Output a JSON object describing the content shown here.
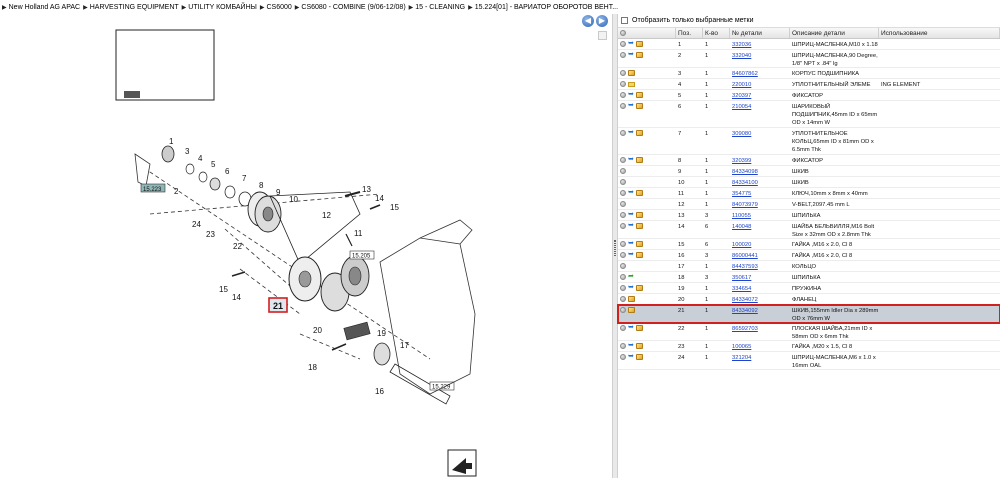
{
  "breadcrumb": [
    "New Holland AG APAC",
    "HARVESTING EQUIPMENT",
    "UTILITY КОМБАЙНЫ",
    "CS6000",
    "CS6080 - COMBINE (9/06-12/08)",
    "15 - CLEANING",
    "15.224[01] - ВАРИАТОР ОБОРОТОВ ВЕНТ..."
  ],
  "nav": {
    "back_icon": "arrow-left-icon",
    "forward_icon": "arrow-right-icon"
  },
  "filter": {
    "label": "Отобразить только выбранные метки",
    "checked": false
  },
  "columns": {
    "pos": "Поз.",
    "qty": "К-во",
    "part": "№ детали",
    "desc": "Описание детали",
    "usage": "Использование"
  },
  "diagram": {
    "callouts": [
      "1",
      "2",
      "3",
      "4",
      "5",
      "6",
      "7",
      "8",
      "9",
      "10",
      "11",
      "12",
      "13",
      "14",
      "15",
      "16",
      "17",
      "18",
      "19",
      "20",
      "21",
      "22",
      "23",
      "24"
    ],
    "refs": {
      "a": "15.223",
      "b": "15.205",
      "c": "15.229"
    },
    "selected": "21"
  },
  "rows": [
    {
      "icons": [
        "circ",
        "blue",
        "box"
      ],
      "pos": "1",
      "qty": "1",
      "part": "332036",
      "desc": "ШПРИЦ-МАСЛЕНКА,M10 x 1.18",
      "usage": ""
    },
    {
      "icons": [
        "circ",
        "blue",
        "box"
      ],
      "pos": "2",
      "qty": "1",
      "part": "332040",
      "desc": "ШПРИЦ-МАСЛЕНКА,90 Degree, 1/8\" NPT x .84\" lg",
      "usage": ""
    },
    {
      "icons": [
        "circ",
        "box"
      ],
      "pos": "3",
      "qty": "1",
      "part": "84607862",
      "desc": "КОРПУС ПОДШИПНИКА",
      "usage": ""
    },
    {
      "icons": [
        "circ",
        "env"
      ],
      "pos": "4",
      "qty": "1",
      "part": "220010",
      "desc": "УПЛОТНИТЕЛЬНЫЙ ЭЛЕМЕ",
      "usage": "ING ELEMENT"
    },
    {
      "icons": [
        "circ",
        "blue",
        "box"
      ],
      "pos": "5",
      "qty": "1",
      "part": "320397",
      "desc": "ФИКСАТОР",
      "usage": ""
    },
    {
      "icons": [
        "circ",
        "blue",
        "box"
      ],
      "pos": "6",
      "qty": "1",
      "part": "210054",
      "desc": "ШАРИКОВЫЙ ПОДШИПНИК,45mm ID x 65mm OD x 14mm W",
      "usage": ""
    },
    {
      "icons": [
        "circ",
        "blue",
        "box"
      ],
      "pos": "7",
      "qty": "1",
      "part": "309080",
      "desc": "УПЛОТНИТЕЛЬНОЕ КОЛЬЦ,65mm ID x 81mm OD x 6.5mm Thk",
      "usage": ""
    },
    {
      "icons": [
        "circ",
        "blue",
        "box"
      ],
      "pos": "8",
      "qty": "1",
      "part": "320399",
      "desc": "ФИКСАТОР",
      "usage": ""
    },
    {
      "icons": [
        "circ"
      ],
      "pos": "9",
      "qty": "1",
      "part": "84334098",
      "desc": "ШКИВ",
      "usage": ""
    },
    {
      "icons": [
        "circ"
      ],
      "pos": "10",
      "qty": "1",
      "part": "84334100",
      "desc": "ШКИВ",
      "usage": ""
    },
    {
      "icons": [
        "circ",
        "blue",
        "box"
      ],
      "pos": "11",
      "qty": "1",
      "part": "354775",
      "desc": "КЛЮЧ,10mm x 8mm x 40mm",
      "usage": ""
    },
    {
      "icons": [
        "circ"
      ],
      "pos": "12",
      "qty": "1",
      "part": "84073979",
      "desc": "V-BELT,2097.45 mm L",
      "usage": ""
    },
    {
      "icons": [
        "circ",
        "blue",
        "box"
      ],
      "pos": "13",
      "qty": "3",
      "part": "110055",
      "desc": "ШПИЛЬКА",
      "usage": ""
    },
    {
      "icons": [
        "circ",
        "blue",
        "box"
      ],
      "pos": "14",
      "qty": "6",
      "part": "140048",
      "desc": "ШАЙБА БЕЛЬВИЛЛЯ,M16 Bolt Size x 32mm OD x 2.8mm Thk",
      "usage": ""
    },
    {
      "icons": [
        "circ",
        "blue",
        "box"
      ],
      "pos": "15",
      "qty": "6",
      "part": "100020",
      "desc": "ГАЙКА ,M16 x 2.0, Cl 8",
      "usage": ""
    },
    {
      "icons": [
        "circ",
        "blue",
        "box"
      ],
      "pos": "16",
      "qty": "3",
      "part": "86000441",
      "desc": "ГАЙКА ,M16 x 2.0, Cl 8",
      "usage": ""
    },
    {
      "icons": [
        "circ"
      ],
      "pos": "17",
      "qty": "1",
      "part": "84437593",
      "desc": "КОЛЬЦО",
      "usage": ""
    },
    {
      "icons": [
        "circ",
        "green"
      ],
      "pos": "18",
      "qty": "3",
      "part": "350617",
      "desc": "ШПИЛЬКА",
      "usage": ""
    },
    {
      "icons": [
        "circ",
        "blue",
        "box"
      ],
      "pos": "19",
      "qty": "1",
      "part": "334654",
      "desc": "ПРУЖИНА",
      "usage": ""
    },
    {
      "icons": [
        "circ",
        "box"
      ],
      "pos": "20",
      "qty": "1",
      "part": "84334072",
      "desc": "ФЛАНЕЦ",
      "usage": ""
    },
    {
      "icons": [
        "circ",
        "box"
      ],
      "pos": "21",
      "qty": "1",
      "part": "84334092",
      "desc": "ШКИВ,155mm Idler Dia x 289mm OD x 76mm W",
      "usage": "",
      "selected": true
    },
    {
      "icons": [
        "circ",
        "blue",
        "box"
      ],
      "pos": "22",
      "qty": "1",
      "part": "86592703",
      "desc": "ПЛОСКАЯ ШАЙБА,21mm ID x 58mm OD x 6mm Thk",
      "usage": ""
    },
    {
      "icons": [
        "circ",
        "blue",
        "box"
      ],
      "pos": "23",
      "qty": "1",
      "part": "100065",
      "desc": "ГАЙКА ,M20 x 1.5, Cl 8",
      "usage": ""
    },
    {
      "icons": [
        "circ",
        "blue",
        "box"
      ],
      "pos": "24",
      "qty": "1",
      "part": "321204",
      "desc": "ШПРИЦ-МАСЛЕНКА,M6 x 1.0 x 16mm OAL",
      "usage": ""
    }
  ]
}
